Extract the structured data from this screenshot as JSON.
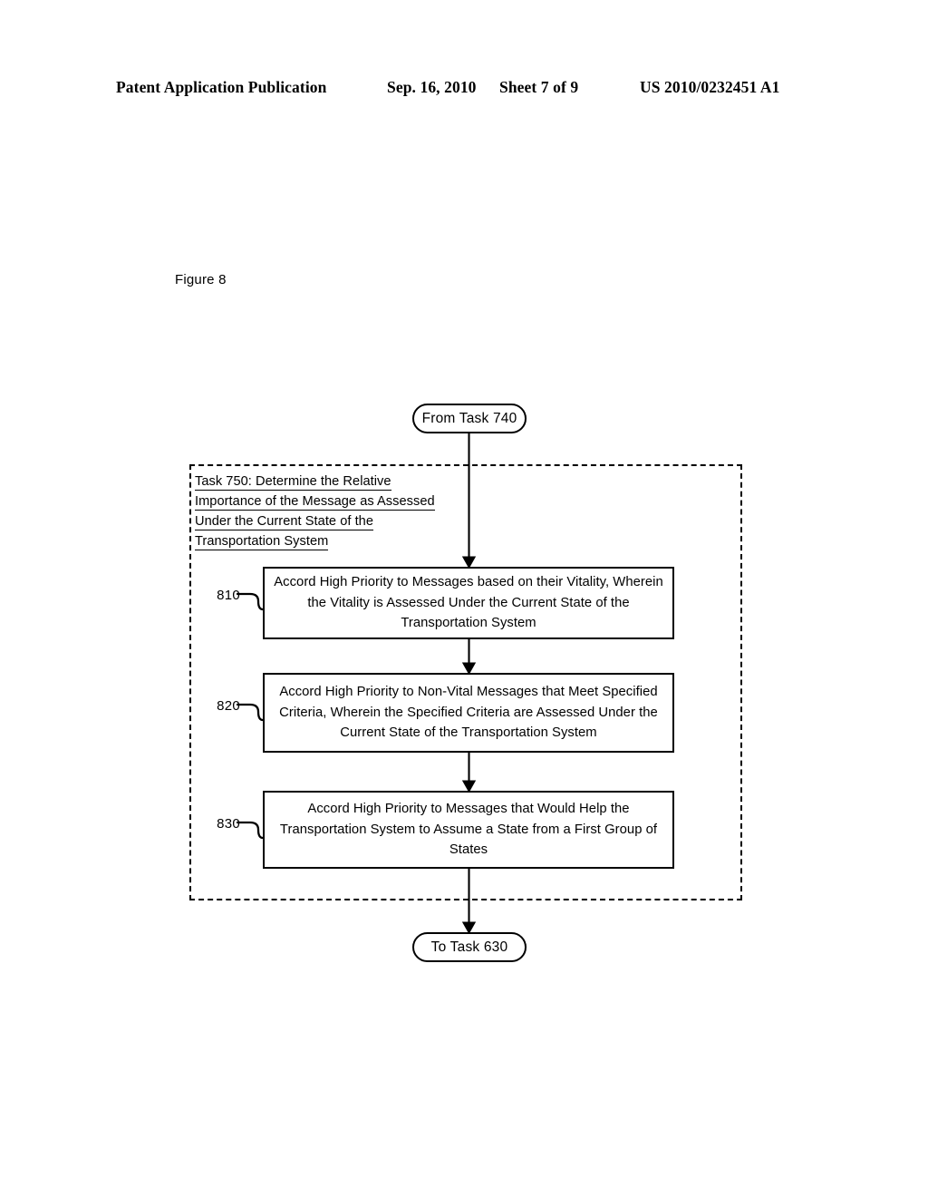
{
  "header": {
    "publication": "Patent Application Publication",
    "date": "Sep. 16, 2010",
    "sheet": "Sheet 7 of 9",
    "patent_number": "US 2010/0232451 A1"
  },
  "figure": {
    "caption": "Figure 8"
  },
  "flowchart": {
    "entry_terminator": "From Task 740",
    "exit_terminator": "To Task 630",
    "container": {
      "title_lines": [
        "Task 750: Determine the Relative",
        "Importance of the Message as Assessed",
        "Under the Current State of the",
        "Transportation System"
      ]
    },
    "steps": [
      {
        "ref": "810",
        "text": "Accord High Priority to Messages based on their Vitality, Wherein the Vitality is Assessed Under the Current State of the Transportation System"
      },
      {
        "ref": "820",
        "text": "Accord High Priority to Non-Vital Messages that Meet Specified Criteria, Wherein the Specified Criteria are Assessed Under the Current State of the Transportation System"
      },
      {
        "ref": "830",
        "text": "Accord High Priority to Messages that Would Help the Transportation System to Assume a State from a First Group of States"
      }
    ]
  },
  "colors": {
    "ink": "#000000",
    "paper": "#ffffff"
  }
}
